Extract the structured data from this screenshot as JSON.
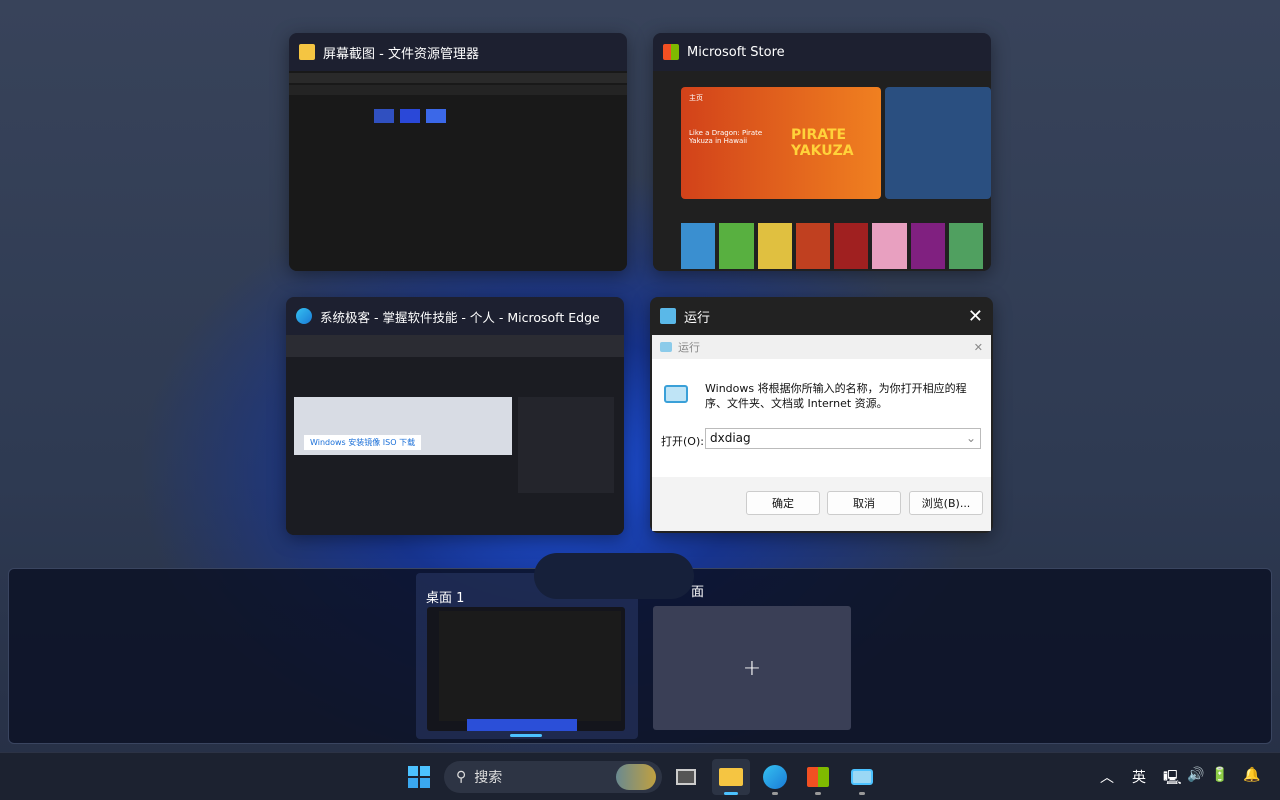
{
  "windows": {
    "explorer": {
      "title": "屏幕截图 - 文件资源管理器"
    },
    "store": {
      "title": "Microsoft Store",
      "hero_title": "Like a Dragon: Pirate Yakuza in Hawaii",
      "home": "主页",
      "game_logo": "PIRATE YAKUZA"
    },
    "edge": {
      "title": "系统极客 - 掌握软件技能 - 个人 - Microsoft Edge",
      "banner": "Windows 安装镜像 ISO 下载"
    },
    "run": {
      "title": "运行",
      "inner_title": "运行",
      "description": "Windows 将根据你所输入的名称，为你打开相应的程序、文件夹、文档或 Internet 资源。",
      "open_label": "打开(O):",
      "open_value": "dxdiag",
      "ok": "确定",
      "cancel": "取消",
      "browse": "浏览(B)..."
    }
  },
  "desktops": [
    {
      "label": "桌面 1"
    },
    {
      "label": "面"
    }
  ],
  "taskbar": {
    "search_placeholder": "搜索",
    "ime": "英"
  }
}
